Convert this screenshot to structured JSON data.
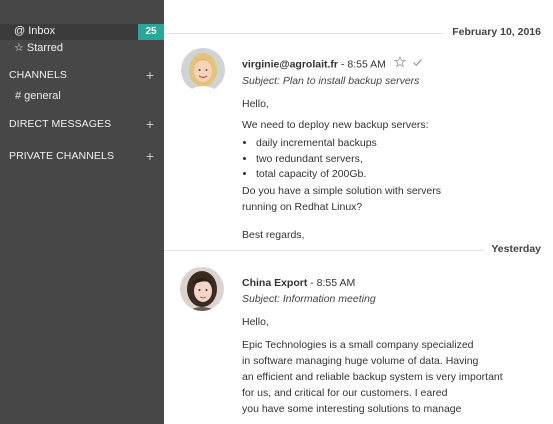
{
  "sidebar": {
    "inbox": {
      "label": "@ Inbox",
      "count": "25"
    },
    "starred": {
      "label": "☆ Starred"
    },
    "sections": [
      {
        "label": "CHANNELS",
        "action": "+"
      },
      {
        "label": "DIRECT MESSAGES",
        "action": "+"
      },
      {
        "label": "PRIVATE CHANNELS",
        "action": "+"
      }
    ],
    "channels": [
      {
        "label": "# general"
      }
    ]
  },
  "messages": [
    {
      "date": "February 10, 2016",
      "sender": "virginie@agrolait.fr",
      "time": " - 8:55 AM",
      "subject": "Subject: Plan to install backup servers",
      "greeting": "Hello,",
      "intro": "We need to deploy new backup servers:",
      "bullets": [
        "daily incremental backups",
        "two redundant servers,",
        "total capacity of 200Gb."
      ],
      "question_1": "Do you have a simple solution with servers",
      "question_2": "running on Redhat Linux?",
      "signoff": "Best regards,"
    },
    {
      "date": "Yesterday",
      "sender": "China Export",
      "time": " - 8:55 AM",
      "subject": "Subject: Information meeting",
      "greeting": "Hello,",
      "body": [
        "Epic Technologies is a small company specialized",
        "in software managing huge volume of data. Having",
        "an efficient and reliable backup system is very important",
        "for us, and critical for our customers. I eared",
        "you have some interesting solutions to manage"
      ]
    }
  ],
  "colors": {
    "sidebar": "#474747",
    "badge": "#2aa69a",
    "selected_row": "#3b3b3b"
  }
}
